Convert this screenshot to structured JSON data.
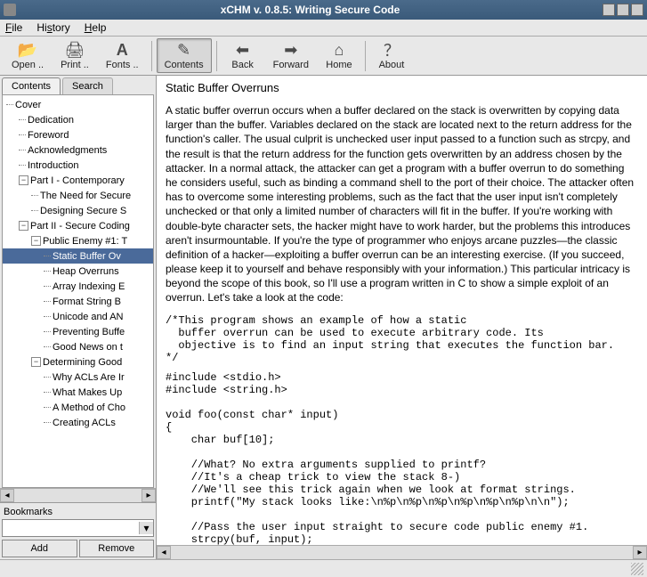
{
  "window": {
    "title": "xCHM v. 0.8.5: Writing Secure Code"
  },
  "menu": {
    "file": "File",
    "history": "History",
    "help": "Help"
  },
  "toolbar": {
    "open": "Open ..",
    "print": "Print ..",
    "fonts": "Fonts ..",
    "contents": "Contents",
    "back": "Back",
    "forward": "Forward",
    "home": "Home",
    "about": "About"
  },
  "tabs": {
    "contents": "Contents",
    "search": "Search"
  },
  "tree": [
    {
      "level": 0,
      "toggle": "",
      "label": "Cover",
      "selected": false
    },
    {
      "level": 1,
      "toggle": "",
      "label": "Dedication",
      "selected": false
    },
    {
      "level": 1,
      "toggle": "",
      "label": "Foreword",
      "selected": false
    },
    {
      "level": 1,
      "toggle": "",
      "label": "Acknowledgments",
      "selected": false
    },
    {
      "level": 1,
      "toggle": "",
      "label": "Introduction",
      "selected": false
    },
    {
      "level": 1,
      "toggle": "−",
      "label": "Part I - Contemporary",
      "selected": false
    },
    {
      "level": 2,
      "toggle": "",
      "label": "The Need for Secure",
      "selected": false
    },
    {
      "level": 2,
      "toggle": "",
      "label": "Designing Secure S",
      "selected": false
    },
    {
      "level": 1,
      "toggle": "−",
      "label": "Part II - Secure Coding",
      "selected": false
    },
    {
      "level": 2,
      "toggle": "−",
      "label": "Public Enemy #1: T",
      "selected": false
    },
    {
      "level": 3,
      "toggle": "",
      "label": "Static Buffer Ov",
      "selected": true
    },
    {
      "level": 3,
      "toggle": "",
      "label": "Heap Overruns",
      "selected": false
    },
    {
      "level": 3,
      "toggle": "",
      "label": "Array Indexing E",
      "selected": false
    },
    {
      "level": 3,
      "toggle": "",
      "label": "Format String B",
      "selected": false
    },
    {
      "level": 3,
      "toggle": "",
      "label": "Unicode and AN",
      "selected": false
    },
    {
      "level": 3,
      "toggle": "",
      "label": "Preventing Buffe",
      "selected": false
    },
    {
      "level": 3,
      "toggle": "",
      "label": "Good News on t",
      "selected": false
    },
    {
      "level": 2,
      "toggle": "−",
      "label": "Determining Good",
      "selected": false
    },
    {
      "level": 3,
      "toggle": "",
      "label": "Why ACLs Are Ir",
      "selected": false
    },
    {
      "level": 3,
      "toggle": "",
      "label": "What Makes Up",
      "selected": false
    },
    {
      "level": 3,
      "toggle": "",
      "label": "A Method of Cho",
      "selected": false
    },
    {
      "level": 3,
      "toggle": "",
      "label": "Creating ACLs",
      "selected": false
    }
  ],
  "bookmarks": {
    "label": "Bookmarks",
    "add": "Add",
    "remove": "Remove"
  },
  "content": {
    "heading": "Static Buffer Overruns",
    "para": "A static buffer overrun occurs when a buffer declared on the stack is overwritten by copying data larger than the buffer. Variables declared on the stack are located next to the return address for the function's caller. The usual culprit is unchecked user input passed to a function such as strcpy, and the result is that the return address for the function gets overwritten by an address chosen by the attacker. In a normal attack, the attacker can get a program with a buffer overrun to do something he considers useful, such as binding a command shell to the port of their choice. The attacker often has to overcome some interesting problems, such as the fact that the user input isn't completely unchecked or that only a limited number of characters will fit in the buffer. If you're working with double-byte character sets, the hacker might have to work harder, but the problems this introduces aren't insurmountable. If you're the type of programmer who enjoys arcane puzzles—the classic definition of a hacker—exploiting a buffer overrun can be an interesting exercise. (If you succeed, please keep it to yourself and behave responsibly with your information.) This particular intricacy is beyond the scope of this book, so I'll use a program written in C to show a simple exploit of an overrun. Let's take a look at the code:",
    "code1": "/*This program shows an example of how a static\n  buffer overrun can be used to execute arbitrary code. Its\n  objective is to find an input string that executes the function bar.\n*/",
    "code2": "#include <stdio.h>\n#include <string.h>\n\nvoid foo(const char* input)\n{\n    char buf[10];\n\n    //What? No extra arguments supplied to printf?\n    //It's a cheap trick to view the stack 8-)\n    //We'll see this trick again when we look at format strings.\n    printf(\"My stack looks like:\\n%p\\n%p\\n%p\\n%p\\n%p\\n%p\\n\\n\");\n\n    //Pass the user input straight to secure code public enemy #1.\n    strcpy(buf, input);"
  },
  "status": ""
}
